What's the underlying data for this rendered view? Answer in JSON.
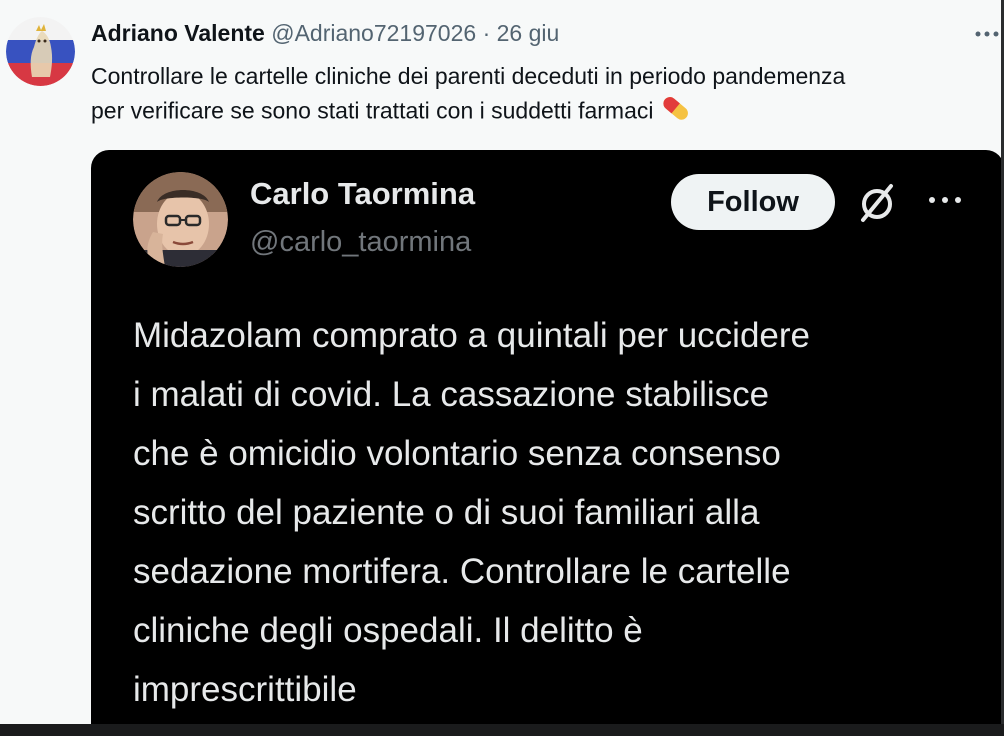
{
  "tweet": {
    "author_name": "Adriano Valente",
    "handle": "@Adriano72197026",
    "separator": "·",
    "date": "26 giu",
    "more_icon": "more-horizontal-icon",
    "text_line1": "Controllare le cartelle cliniche dei parenti deceduti in periodo pandemenza",
    "text_line2": "per verificare se sono stati trattati con i suddetti farmaci",
    "emoji_icon": "pill-icon"
  },
  "embedded": {
    "author_name": "Carlo Taormina",
    "handle": "@carlo_taormina",
    "follow_label": "Follow",
    "x_icon": "x-logo-icon",
    "more_icon": "more-horizontal-icon",
    "text": "Midazolam comprato a quintali per uccidere\ni malati di covid. La cassazione stabilisce\nche è omicidio volontario senza consenso\nscritto del paziente o di suoi familiari alla\nsedazione mortifera. Controllare le cartelle\ncliniche degli ospedali. Il delitto è\nimprescrittibile"
  },
  "colors": {
    "page_bg": "#f7f9f9",
    "text_primary": "#0f1419",
    "text_secondary": "#536471",
    "embed_bg": "#000000",
    "embed_text": "#e7e9ea",
    "embed_secondary": "#71767b",
    "follow_bg": "#eff3f4"
  }
}
